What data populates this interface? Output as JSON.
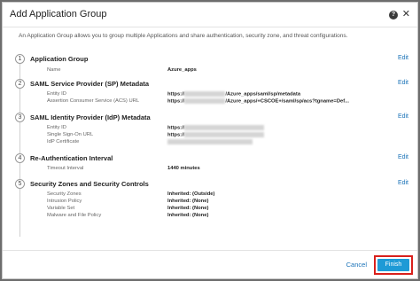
{
  "dialog": {
    "title": "Add Application Group",
    "help_icon": "?",
    "close_icon": "✕",
    "description": "An Application Group allows you to group multiple Applications and share authentication, security zone, and threat configurations."
  },
  "sections": [
    {
      "number": "1",
      "title": "Application Group",
      "edit": "Edit",
      "rows": [
        {
          "label": "Name",
          "value": "Azure_apps"
        }
      ]
    },
    {
      "number": "2",
      "title": "SAML Service Provider (SP) Metadata",
      "edit": "Edit",
      "rows": [
        {
          "label": "Entity ID",
          "value_prefix": "https://",
          "value": "/Azure_apps/saml/sp/metadata"
        },
        {
          "label": "Assertion Consumer Service (ACS) URL",
          "value_prefix": "https://",
          "value": "/Azure_apps/+CSCOE+/saml/sp/acs?tgname=Def..."
        }
      ]
    },
    {
      "number": "3",
      "title": "SAML Identity Provider (IdP) Metadata",
      "edit": "Edit",
      "rows": [
        {
          "label": "Entity ID",
          "value": "https://"
        },
        {
          "label": "Single Sign-On URL",
          "value": "https://"
        },
        {
          "label": "IdP Certificate",
          "value": ""
        }
      ]
    },
    {
      "number": "4",
      "title": "Re-Authentication Interval",
      "edit": "Edit",
      "rows": [
        {
          "label": "Timeout Interval",
          "value": "1440 minutes"
        }
      ]
    },
    {
      "number": "5",
      "title": "Security Zones and Security Controls",
      "edit": "Edit",
      "rows": [
        {
          "label": "Security Zones",
          "value": "Inherited: (Outside)"
        },
        {
          "label": "Intrusion Policy",
          "value": "Inherited: (None)"
        },
        {
          "label": "Variable Set",
          "value": "Inherited: (None)"
        },
        {
          "label": "Malware and File Policy",
          "value": "Inherited: (None)"
        }
      ]
    }
  ],
  "footer": {
    "cancel_label": "Cancel",
    "finish_label": "Finish"
  },
  "colors": {
    "link": "#1a73b8",
    "primary_button": "#1e9ad6",
    "highlight_border": "#d9201c"
  }
}
